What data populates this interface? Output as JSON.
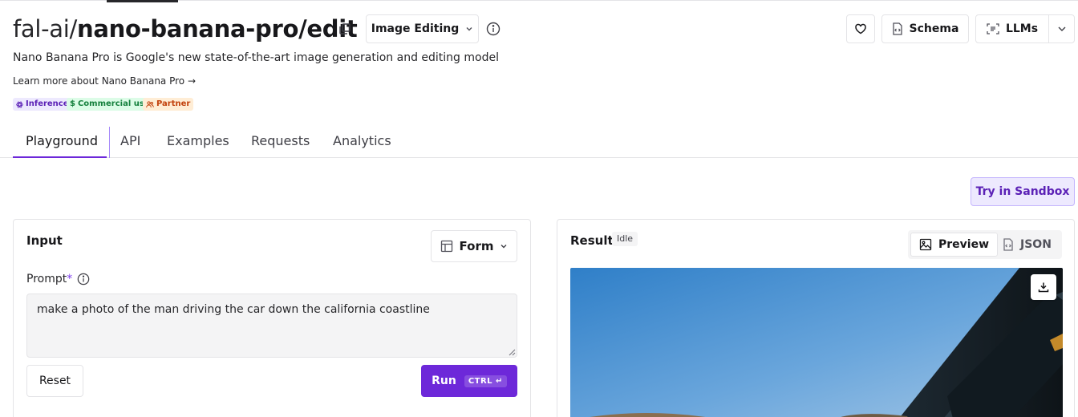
{
  "header": {
    "owner": "fal-ai/",
    "model": "nano-banana-pro/edit",
    "category": "Image Editing",
    "description": "Nano Banana Pro is Google's new state-of-the-art image generation and editing model",
    "learn_more": "Learn more about Nano Banana Pro →",
    "badges": [
      {
        "label": "Inference",
        "icon": "atom-icon",
        "color": "#5b21b6"
      },
      {
        "label": "Commercial use",
        "icon": "dollar-icon",
        "color": "#15803d"
      },
      {
        "label": "Partner",
        "icon": "users-icon",
        "color": "#c2410c"
      }
    ],
    "actions": {
      "schema": "Schema",
      "llms": "LLMs"
    }
  },
  "tabs": [
    {
      "label": "Playground",
      "active": true
    },
    {
      "label": "API",
      "active": false
    },
    {
      "label": "Examples",
      "active": false
    },
    {
      "label": "Requests",
      "active": false
    },
    {
      "label": "Analytics",
      "active": false
    }
  ],
  "sandbox_label": "Try in Sandbox",
  "input_panel": {
    "title": "Input",
    "mode": "Form",
    "prompt_label": "Prompt",
    "prompt_required": "*",
    "prompt_value": "make a photo of the man driving the car down the california coastline",
    "reset": "Reset",
    "run": "Run",
    "run_shortcut": "CTRL ↵"
  },
  "result_panel": {
    "title": "Result",
    "status": "Idle",
    "views": [
      {
        "label": "Preview",
        "icon": "image-icon",
        "active": true
      },
      {
        "label": "JSON",
        "icon": "file-code-icon",
        "active": false
      }
    ]
  },
  "colors": {
    "accent": "#6d28d9",
    "accent_light": "#ede9fe",
    "border": "#e4e4e7"
  }
}
